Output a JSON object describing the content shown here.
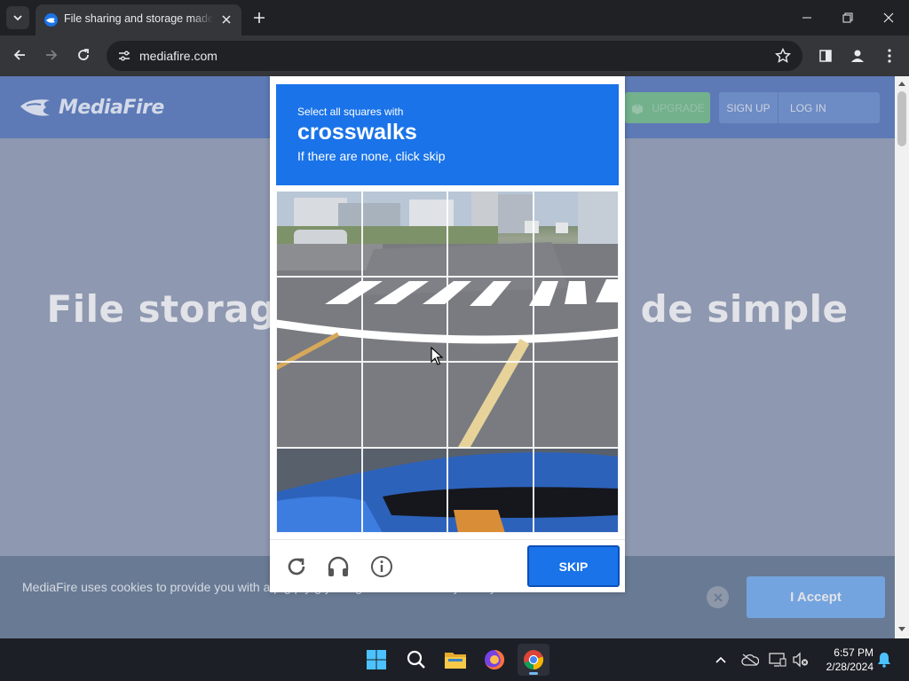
{
  "browser": {
    "tab": {
      "title": "File sharing and storage made simple"
    },
    "url": "mediafire.com"
  },
  "page": {
    "logo_text": "MediaFire",
    "nav": {
      "upgrade": "UPGRADE",
      "signup": "SIGN UP",
      "login": "LOG IN"
    },
    "hero_left": "File storag",
    "hero_right": "de simple",
    "cookie": {
      "text": "MediaFire uses cookies to provide you with a p                                                          g                    p                     y                                  g                            you agree to our Privacy Policy..",
      "accept": "I Accept"
    }
  },
  "captcha": {
    "instruction": "Select all squares with",
    "keyword": "crosswalks",
    "subtext": "If there are none, click skip",
    "grid": {
      "rows": 4,
      "cols": 4
    },
    "skip_label": "SKIP",
    "header_color": "#1a73e8"
  },
  "taskbar": {
    "time": "6:57 PM",
    "date": "2/28/2024",
    "apps": [
      "windows-start",
      "search",
      "file-explorer",
      "firefox",
      "chrome"
    ]
  },
  "colors": {
    "accent": "#1a73e8",
    "mf_header": "#5e7fc2"
  }
}
